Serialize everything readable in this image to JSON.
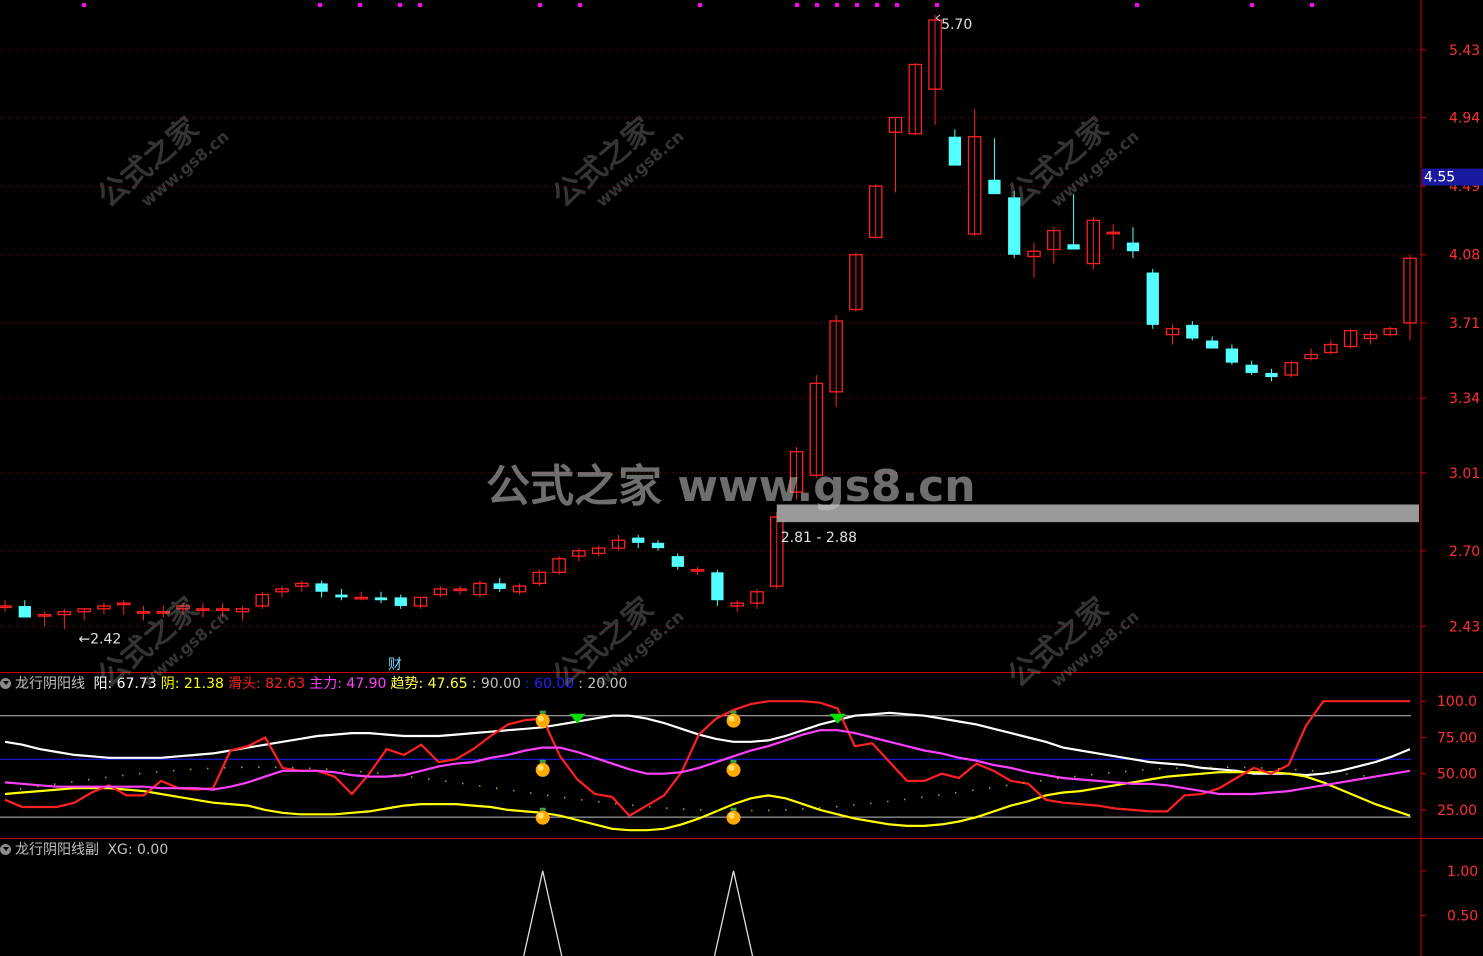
{
  "chart_data": [
    {
      "type": "candlestick",
      "panel": "main",
      "y_ticks": [
        "5.43",
        "4.94",
        "4.49",
        "4.08",
        "3.71",
        "3.34",
        "3.01",
        "2.70",
        "2.43"
      ],
      "y_range": [
        2.28,
        5.78
      ],
      "y_scale": "log",
      "current_price_label": "4.55",
      "current_price": 4.55,
      "max_label": "5.70",
      "min_label": "2.42",
      "range_label": "2.81 - 2.88",
      "range_band": [
        2.81,
        2.88
      ],
      "news_marker": "财",
      "candles": [
        {
          "o": 2.5,
          "h": 2.52,
          "l": 2.48,
          "c": 2.5
        },
        {
          "o": 2.5,
          "h": 2.52,
          "l": 2.46,
          "c": 2.46
        },
        {
          "o": 2.47,
          "h": 2.48,
          "l": 2.43,
          "c": 2.47
        },
        {
          "o": 2.47,
          "h": 2.49,
          "l": 2.42,
          "c": 2.48
        },
        {
          "o": 2.48,
          "h": 2.49,
          "l": 2.45,
          "c": 2.49
        },
        {
          "o": 2.49,
          "h": 2.51,
          "l": 2.47,
          "c": 2.5
        },
        {
          "o": 2.51,
          "h": 2.52,
          "l": 2.47,
          "c": 2.51
        },
        {
          "o": 2.48,
          "h": 2.5,
          "l": 2.45,
          "c": 2.48
        },
        {
          "o": 2.48,
          "h": 2.5,
          "l": 2.46,
          "c": 2.48
        },
        {
          "o": 2.49,
          "h": 2.51,
          "l": 2.47,
          "c": 2.5
        },
        {
          "o": 2.49,
          "h": 2.51,
          "l": 2.46,
          "c": 2.49
        },
        {
          "o": 2.49,
          "h": 2.51,
          "l": 2.46,
          "c": 2.49
        },
        {
          "o": 2.48,
          "h": 2.5,
          "l": 2.45,
          "c": 2.49
        },
        {
          "o": 2.5,
          "h": 2.55,
          "l": 2.49,
          "c": 2.54
        },
        {
          "o": 2.55,
          "h": 2.57,
          "l": 2.53,
          "c": 2.56
        },
        {
          "o": 2.57,
          "h": 2.59,
          "l": 2.55,
          "c": 2.58
        },
        {
          "o": 2.58,
          "h": 2.59,
          "l": 2.53,
          "c": 2.55
        },
        {
          "o": 2.54,
          "h": 2.56,
          "l": 2.52,
          "c": 2.53
        },
        {
          "o": 2.53,
          "h": 2.55,
          "l": 2.52,
          "c": 2.53
        },
        {
          "o": 2.53,
          "h": 2.55,
          "l": 2.51,
          "c": 2.52
        },
        {
          "o": 2.53,
          "h": 2.54,
          "l": 2.49,
          "c": 2.5
        },
        {
          "o": 2.5,
          "h": 2.53,
          "l": 2.49,
          "c": 2.53
        },
        {
          "o": 2.54,
          "h": 2.57,
          "l": 2.53,
          "c": 2.56
        },
        {
          "o": 2.56,
          "h": 2.57,
          "l": 2.54,
          "c": 2.56
        },
        {
          "o": 2.54,
          "h": 2.59,
          "l": 2.53,
          "c": 2.58
        },
        {
          "o": 2.58,
          "h": 2.6,
          "l": 2.55,
          "c": 2.56
        },
        {
          "o": 2.55,
          "h": 2.58,
          "l": 2.54,
          "c": 2.57
        },
        {
          "o": 2.58,
          "h": 2.63,
          "l": 2.57,
          "c": 2.62
        },
        {
          "o": 2.62,
          "h": 2.68,
          "l": 2.61,
          "c": 2.67
        },
        {
          "o": 2.68,
          "h": 2.71,
          "l": 2.66,
          "c": 2.7
        },
        {
          "o": 2.69,
          "h": 2.72,
          "l": 2.68,
          "c": 2.71
        },
        {
          "o": 2.71,
          "h": 2.76,
          "l": 2.7,
          "c": 2.74
        },
        {
          "o": 2.75,
          "h": 2.76,
          "l": 2.71,
          "c": 2.73
        },
        {
          "o": 2.73,
          "h": 2.74,
          "l": 2.7,
          "c": 2.71
        },
        {
          "o": 2.68,
          "h": 2.69,
          "l": 2.63,
          "c": 2.64
        },
        {
          "o": 2.63,
          "h": 2.64,
          "l": 2.61,
          "c": 2.63
        },
        {
          "o": 2.62,
          "h": 2.63,
          "l": 2.5,
          "c": 2.52
        },
        {
          "o": 2.5,
          "h": 2.52,
          "l": 2.48,
          "c": 2.51
        },
        {
          "o": 2.51,
          "h": 2.56,
          "l": 2.49,
          "c": 2.55
        },
        {
          "o": 2.57,
          "h": 2.85,
          "l": 2.56,
          "c": 2.83
        },
        {
          "o": 2.93,
          "h": 3.12,
          "l": 2.9,
          "c": 3.1
        },
        {
          "o": 3.0,
          "h": 3.45,
          "l": 2.99,
          "c": 3.41
        },
        {
          "o": 3.37,
          "h": 3.75,
          "l": 3.3,
          "c": 3.72
        },
        {
          "o": 3.78,
          "h": 4.09,
          "l": 3.77,
          "c": 4.08
        },
        {
          "o": 4.18,
          "h": 4.5,
          "l": 4.17,
          "c": 4.49
        },
        {
          "o": 4.84,
          "h": 4.94,
          "l": 4.45,
          "c": 4.94
        },
        {
          "o": 4.83,
          "h": 5.33,
          "l": 4.82,
          "c": 5.32
        },
        {
          "o": 5.14,
          "h": 5.7,
          "l": 4.89,
          "c": 5.66
        },
        {
          "o": 4.81,
          "h": 4.86,
          "l": 4.62,
          "c": 4.62
        },
        {
          "o": 4.2,
          "h": 5.0,
          "l": 4.19,
          "c": 4.81
        },
        {
          "o": 4.53,
          "h": 4.8,
          "l": 4.44,
          "c": 4.44
        },
        {
          "o": 4.42,
          "h": 4.46,
          "l": 4.06,
          "c": 4.08
        },
        {
          "o": 4.07,
          "h": 4.15,
          "l": 3.95,
          "c": 4.1
        },
        {
          "o": 4.11,
          "h": 4.24,
          "l": 4.03,
          "c": 4.22
        },
        {
          "o": 4.14,
          "h": 4.44,
          "l": 4.11,
          "c": 4.11
        },
        {
          "o": 4.03,
          "h": 4.3,
          "l": 4.0,
          "c": 4.28
        },
        {
          "o": 4.21,
          "h": 4.26,
          "l": 4.11,
          "c": 4.21
        },
        {
          "o": 4.15,
          "h": 4.24,
          "l": 4.06,
          "c": 4.1
        },
        {
          "o": 3.98,
          "h": 4.0,
          "l": 3.68,
          "c": 3.7
        },
        {
          "o": 3.65,
          "h": 3.7,
          "l": 3.6,
          "c": 3.68
        },
        {
          "o": 3.7,
          "h": 3.72,
          "l": 3.62,
          "c": 3.63
        },
        {
          "o": 3.62,
          "h": 3.64,
          "l": 3.58,
          "c": 3.58
        },
        {
          "o": 3.58,
          "h": 3.6,
          "l": 3.5,
          "c": 3.51
        },
        {
          "o": 3.5,
          "h": 3.52,
          "l": 3.45,
          "c": 3.46
        },
        {
          "o": 3.46,
          "h": 3.48,
          "l": 3.42,
          "c": 3.44
        },
        {
          "o": 3.45,
          "h": 3.52,
          "l": 3.44,
          "c": 3.51
        },
        {
          "o": 3.53,
          "h": 3.58,
          "l": 3.52,
          "c": 3.55
        },
        {
          "o": 3.56,
          "h": 3.62,
          "l": 3.55,
          "c": 3.6
        },
        {
          "o": 3.59,
          "h": 3.68,
          "l": 3.58,
          "c": 3.67
        },
        {
          "o": 3.63,
          "h": 3.67,
          "l": 3.6,
          "c": 3.65
        },
        {
          "o": 3.65,
          "h": 3.69,
          "l": 3.64,
          "c": 3.68
        },
        {
          "o": 3.71,
          "h": 4.08,
          "l": 3.62,
          "c": 4.06
        }
      ]
    },
    {
      "type": "line",
      "panel": "indicator",
      "title": "龙行阴阳线",
      "legend": [
        {
          "label": "阳",
          "value": "67.73",
          "color": "#ffffff"
        },
        {
          "label": "阴",
          "value": "21.38",
          "color": "#ffff00"
        },
        {
          "label": "滑头",
          "value": "82.63",
          "color": "#ff2020"
        },
        {
          "label": "主力",
          "value": "47.90",
          "color": "#ff40ff"
        },
        {
          "label": "趋势",
          "value": "47.65",
          "color": "#ffff40"
        },
        {
          "label": "",
          "value": "90.00",
          "color": "#c0c0c0"
        },
        {
          "label": "",
          "value": "60.00",
          "color": "#2020ff"
        },
        {
          "label": "",
          "value": "20.00",
          "color": "#c0c0c0"
        }
      ],
      "y_ticks": [
        "100.0",
        "75.00",
        "50.00",
        "25.00"
      ],
      "y_range": [
        7,
        105
      ],
      "levels": [
        {
          "value": 90,
          "color": "#c0c0c0"
        },
        {
          "value": 60,
          "color": "#2020ff"
        },
        {
          "value": 20,
          "color": "#c0c0c0"
        }
      ],
      "series": [
        {
          "name": "阳",
          "color": "#ffffff",
          "values": [
            72,
            70,
            67,
            65,
            63,
            62,
            61,
            61,
            61,
            61,
            62,
            63,
            64,
            66,
            68,
            70,
            72,
            74,
            76,
            77,
            78,
            78,
            77,
            76,
            76,
            76,
            77,
            78,
            79,
            80,
            81,
            82,
            84,
            86,
            88,
            90,
            90,
            88,
            85,
            81,
            77,
            74,
            72,
            72,
            73,
            76,
            80,
            84,
            87,
            90,
            91,
            92,
            91,
            90,
            88,
            86,
            84,
            81,
            78,
            75,
            72,
            68,
            66,
            64,
            62,
            60,
            58,
            57,
            56,
            54,
            53,
            52,
            50,
            50,
            50,
            49,
            50,
            52,
            55,
            58,
            62,
            67
          ]
        },
        {
          "name": "阴",
          "color": "#ffff00",
          "values": [
            36,
            37,
            38,
            39,
            40,
            40,
            40,
            39,
            38,
            36,
            34,
            32,
            30,
            29,
            28,
            25,
            23,
            22,
            22,
            22,
            23,
            24,
            26,
            28,
            29,
            29,
            29,
            28,
            27,
            25,
            24,
            23,
            21,
            18,
            15,
            12,
            11,
            11,
            12,
            15,
            19,
            24,
            29,
            33,
            35,
            33,
            29,
            25,
            22,
            19,
            17,
            15,
            14,
            14,
            15,
            17,
            20,
            24,
            28,
            31,
            35,
            37,
            38,
            40,
            42,
            44,
            46,
            48,
            49,
            50,
            51,
            51,
            51,
            51,
            50,
            48,
            44,
            39,
            34,
            29,
            25,
            21
          ]
        },
        {
          "name": "滑头",
          "color": "#ff2020",
          "values": [
            32,
            27,
            27,
            27,
            30,
            37,
            42,
            35,
            35,
            45,
            40,
            39,
            40,
            66,
            69,
            75,
            54,
            52,
            52,
            48,
            36,
            50,
            67,
            63,
            70,
            58,
            60,
            67,
            76,
            84,
            87,
            88,
            62,
            46,
            36,
            34,
            21,
            28,
            35,
            51,
            77,
            88,
            94,
            98,
            100,
            100,
            100,
            99,
            95,
            69,
            71,
            58,
            45,
            45,
            50,
            47,
            57,
            52,
            45,
            43,
            32,
            30,
            29,
            28,
            26,
            25,
            24,
            24,
            35,
            36,
            40,
            47,
            54,
            50,
            56,
            83,
            100,
            100,
            100,
            100,
            100,
            100
          ]
        },
        {
          "name": "主力",
          "color": "#ff40ff",
          "values": [
            44,
            43,
            42,
            41,
            41,
            41,
            41,
            41,
            41,
            40,
            40,
            40,
            39,
            41,
            44,
            48,
            52,
            52,
            52,
            51,
            49,
            48,
            48,
            49,
            52,
            55,
            57,
            58,
            61,
            63,
            66,
            68,
            68,
            65,
            61,
            57,
            53,
            50,
            50,
            51,
            54,
            58,
            62,
            66,
            69,
            73,
            77,
            80,
            80,
            78,
            75,
            72,
            69,
            66,
            64,
            61,
            59,
            56,
            54,
            51,
            49,
            47,
            46,
            45,
            44,
            43,
            43,
            42,
            40,
            38,
            36,
            36,
            36,
            37,
            38,
            40,
            42,
            44,
            46,
            48,
            50,
            52
          ]
        }
      ],
      "signals": {
        "green_down_arrows": [
          33,
          48
        ],
        "yellow_dots_cols": [
          31,
          42
        ]
      }
    },
    {
      "type": "line",
      "panel": "sub",
      "title": "龙行阴阳线副",
      "legend": [
        {
          "label": "XG",
          "value": "0.00",
          "color": "#c0c0c0"
        }
      ],
      "y_ticks": [
        "1.00",
        "0.50"
      ],
      "y_range": [
        0,
        1.1
      ],
      "spikes_cols": [
        31,
        42
      ]
    }
  ],
  "watermark": {
    "main": "公式之家 www.gs8.cn",
    "tile_cn": "公式之家",
    "tile_url": "www.gs8.cn"
  },
  "colors": {
    "up": "#ff2020",
    "down": "#54ffff",
    "axis": "#cc0000",
    "grid": "#880000",
    "tick_text": "#ff3030"
  }
}
